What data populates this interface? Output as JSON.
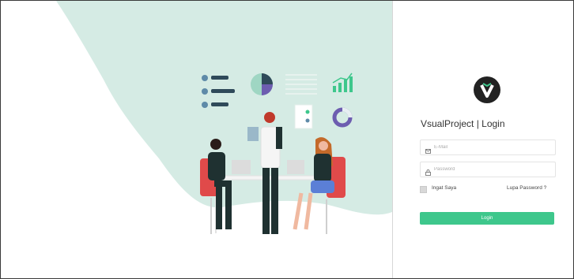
{
  "app": {
    "title": "VsualProject | Login"
  },
  "form": {
    "email_placeholder": "E-Mail",
    "password_placeholder": "Password",
    "remember_label": "Ingat Saya",
    "forgot_label": "Lupa Password ?",
    "login_label": "Login"
  },
  "illustration": {
    "subject": "team-working-at-table",
    "icons": [
      "checklist-icon",
      "pie-chart-icon",
      "bar-chart-icon",
      "donut-chart-icon",
      "document-icon"
    ]
  },
  "colors": {
    "accent": "#3ec78c",
    "blob": "#d5ebe4",
    "chair": "#e04a4a",
    "logo_bg": "#222222",
    "logo_v": "#ffffff",
    "logo_accent": "#3ec78c"
  }
}
